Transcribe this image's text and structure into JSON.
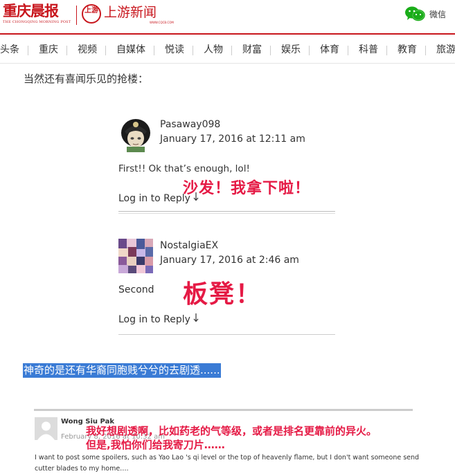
{
  "header": {
    "logo_main": "重庆晨报",
    "logo_sub": "THE CHONGQING MORNING POST",
    "logo2_circle": "上游",
    "logo2_text": "上游新闻",
    "logo2_url": "WWW.CQCB.COM",
    "wechat_label": "微信",
    "accent_color": "#c8161d"
  },
  "nav": [
    "头条",
    "重庆",
    "视频",
    "自媒体",
    "悦读",
    "人物",
    "财富",
    "娱乐",
    "体育",
    "科普",
    "教育",
    "旅游"
  ],
  "intro": "当然还有喜闻乐见的抢楼：",
  "comments": [
    {
      "author": "Pasaway098",
      "date": "January 17, 2016 at 12:11 am",
      "body": "First!! Ok that’s enough, lol!",
      "reply": "Log in to Reply",
      "annotation": "沙发！我拿下啦！"
    },
    {
      "author": "NostalgiaEX",
      "date": "January 17, 2016 at 2:46 am",
      "body": "Second",
      "reply": "Log in to Reply",
      "annotation": "板凳！"
    }
  ],
  "highlight": "神奇的是还有华裔同胞贱兮兮的去剧透......",
  "quoted": {
    "author": "Wong Siu Pak",
    "date": "February 8, 2016 at 10:32 am",
    "annotation_line1": "我好想剧透啊，比如药老的气等级，或者是排名更靠前的异火。",
    "annotation_line2": "但是,我怕你们给我寄刀片……",
    "body": "I want to post some spoilers, such as Yao Lao 's qi level or the top of heavenly flame, but I don't want someone send cutter blades to my home…."
  },
  "annotation_color": "#e51a45",
  "highlight_color": "#3a7bd5"
}
